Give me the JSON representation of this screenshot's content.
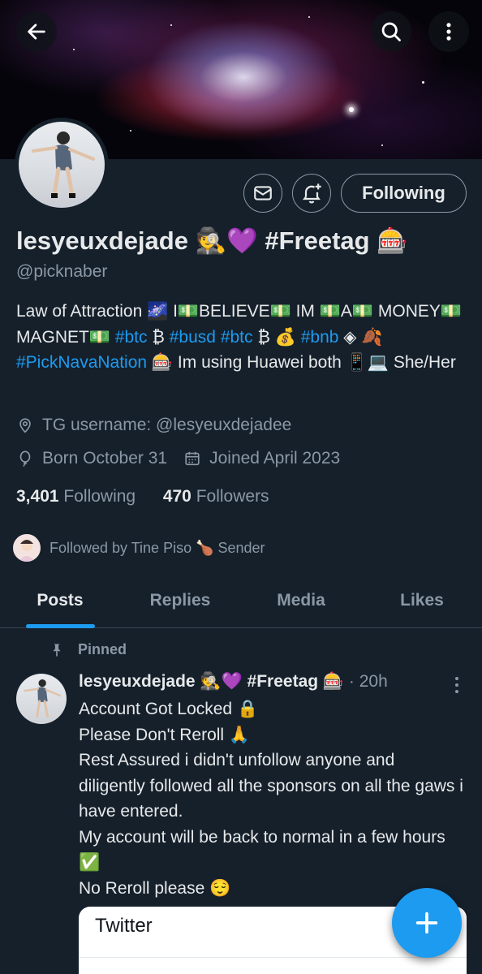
{
  "profile": {
    "display_name": "lesyeuxdejade 🕵💜 #Freetag 🎰",
    "handle": "@picknaber",
    "follow_button": "Following",
    "bio_parts": {
      "p1": "Law of Attraction 🌌 I💵BELIEVE💵 IM 💵A💵 MONEY💵 MAGNET💵 ",
      "t1": "#btc",
      "p2": " ₿ ",
      "t2": "#busd",
      "p3": " ",
      "t3": "#btc",
      "p4": " ₿ 💰 ",
      "t4": "#bnb",
      "p5": " ◈ 🍂 ",
      "t5": "#PickNavaNation",
      "p6": " 🎰 Im using Huawei both 📱💻 She/Her"
    },
    "location": "TG username: @lesyeuxdejadee",
    "birthday": "Born October 31",
    "joined": "Joined April 2023",
    "following_count": "3,401",
    "following_label": "Following",
    "followers_count": "470",
    "followers_label": "Followers",
    "followed_by": "Followed by Tine Piso 🍗 Sender"
  },
  "tabs": [
    "Posts",
    "Replies",
    "Media",
    "Likes"
  ],
  "post": {
    "pinned_label": "Pinned",
    "author": "lesyeuxdejade 🕵💜 #Freetag 🎰",
    "time": " · 20h",
    "lines": [
      "Account Got Locked 🔒",
      "Please Don't Reroll 🙏",
      "Rest Assured i didn't unfollow anyone and diligently followed all the sponsors on all the gaws i have entered.",
      "My account will be back to normal in a few hours ✅",
      "No Reroll please 😌"
    ],
    "card_title": "Twitter"
  },
  "colors": {
    "background": "#15202b",
    "accent": "#1d9bf0",
    "muted": "#8b98a5",
    "text": "#e7e9ea"
  },
  "icons": {
    "back": "back-arrow-icon",
    "search": "search-icon",
    "more": "more-vertical-icon",
    "message": "envelope-icon",
    "notify": "bell-plus-icon",
    "location": "location-pin-icon",
    "birthday": "balloon-icon",
    "joined": "calendar-icon",
    "pinned": "pin-icon",
    "compose": "plus-icon"
  }
}
